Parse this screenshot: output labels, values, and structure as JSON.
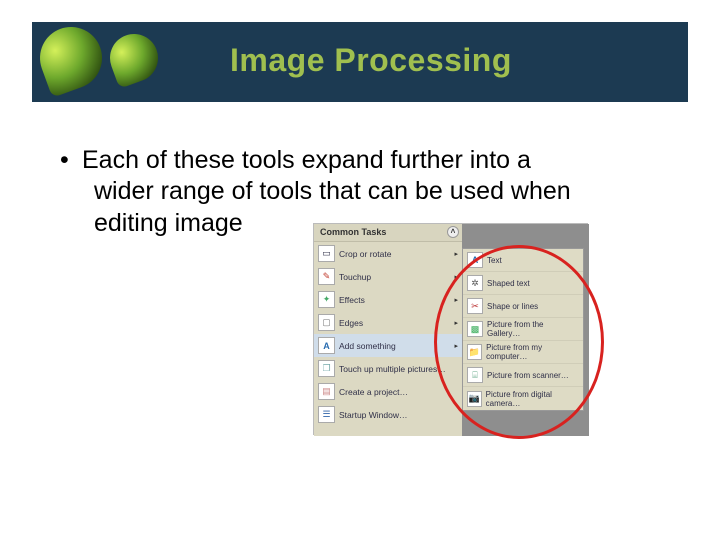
{
  "header": {
    "title": "Image Processing"
  },
  "bullet": {
    "lead": "•",
    "line1": "Each of these tools expand further into a",
    "line2": "wider range of tools that can be used when",
    "line3": "editing image"
  },
  "panel": {
    "header": "Common Tasks",
    "collapse_glyph": "˄",
    "items": [
      {
        "label": "Crop or rotate",
        "icon": "crop-icon",
        "arrow": "▸"
      },
      {
        "label": "Touchup",
        "icon": "brush-icon",
        "arrow": "▸"
      },
      {
        "label": "Effects",
        "icon": "effects-icon",
        "arrow": "▸"
      },
      {
        "label": "Edges",
        "icon": "edges-icon",
        "arrow": "▸"
      },
      {
        "label": "Add something",
        "icon": "add-text-icon",
        "arrow": "▸",
        "selected": true
      },
      {
        "label": "Touch up multiple pictures…",
        "icon": "multi-icon",
        "arrow": ""
      },
      {
        "label": "Create a project…",
        "icon": "project-icon",
        "arrow": ""
      },
      {
        "label": "Startup Window…",
        "icon": "startup-icon",
        "arrow": ""
      }
    ]
  },
  "flyout": {
    "items": [
      {
        "label": "Text",
        "icon": "text-icon"
      },
      {
        "label": "Shaped text",
        "icon": "shaped-text-icon"
      },
      {
        "label": "Shape or lines",
        "icon": "shape-lines-icon"
      },
      {
        "label": "Picture from the Gallery…",
        "icon": "gallery-icon"
      },
      {
        "label": "Picture from my computer…",
        "icon": "computer-icon"
      },
      {
        "label": "Picture from scanner…",
        "icon": "scanner-icon"
      },
      {
        "label": "Picture from digital camera…",
        "icon": "camera-icon"
      }
    ]
  },
  "glyphs": {
    "crop-icon": "▭",
    "brush-icon": "✎",
    "effects-icon": "✦",
    "edges-icon": "▢",
    "add-text-icon": "A",
    "multi-icon": "❐",
    "project-icon": "▤",
    "startup-icon": "☰",
    "text-icon": "A",
    "shaped-text-icon": "✲",
    "shape-lines-icon": "✂",
    "gallery-icon": "▩",
    "computer-icon": "📁",
    "scanner-icon": "⌸",
    "camera-icon": "📷"
  }
}
